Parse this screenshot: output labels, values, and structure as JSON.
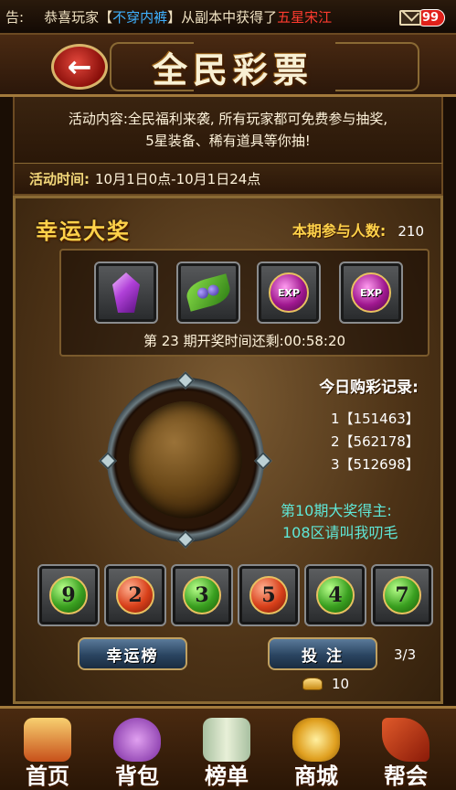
{
  "notice": {
    "label": "告:",
    "prefix": "恭喜玩家",
    "bracket_open": "【",
    "player": "不穿内裤",
    "bracket_close": "】",
    "middle": "从副本中获得了",
    "item": "五星宋江",
    "mail_count": "99"
  },
  "header": {
    "back_icon": "←",
    "title": "全民彩票"
  },
  "description": {
    "line1": "活动内容:全民福利来袭, 所有玩家都可免费参与抽奖,",
    "line2": "5星装备、稀有道具等你抽!"
  },
  "activity_time": {
    "label": "活动时间:",
    "value": "10月1日0点-10月1日24点"
  },
  "lucky": {
    "title": "幸运大奖",
    "participants_label": "本期参与人数:",
    "participants": "210",
    "prizes": [
      {
        "icon": "purple-crystal-icon"
      },
      {
        "icon": "herb-leaf-icon"
      },
      {
        "icon": "exp-orb-icon",
        "text": "EXP"
      },
      {
        "icon": "exp-orb-icon",
        "text": "EXP"
      }
    ],
    "countdown_prefix": "第",
    "round": "23",
    "countdown_mid": "期开奖时间还剩:",
    "countdown": "00:58:20"
  },
  "records": {
    "title": "今日购彩记录:",
    "items": [
      "1【151463】",
      "2【562178】",
      "3【512698】"
    ]
  },
  "winner": {
    "label": "第10期大奖得主:",
    "name": "108区请叫我叨毛"
  },
  "balls": [
    {
      "number": "9",
      "color": "green"
    },
    {
      "number": "2",
      "color": "red"
    },
    {
      "number": "3",
      "color": "green"
    },
    {
      "number": "5",
      "color": "red"
    },
    {
      "number": "4",
      "color": "green"
    },
    {
      "number": "7",
      "color": "green"
    }
  ],
  "actions": {
    "ranking_label": "幸运榜",
    "bet_label": "投 注",
    "bet_count": "3/3",
    "gold": "10"
  },
  "nav": [
    {
      "label": "首页",
      "icon": "palace-icon"
    },
    {
      "label": "背包",
      "icon": "bag-icon"
    },
    {
      "label": "榜单",
      "icon": "scroll-icon"
    },
    {
      "label": "商城",
      "icon": "gold-ingot-icon"
    },
    {
      "label": "帮会",
      "icon": "guild-banner-icon"
    }
  ],
  "colors": {
    "accent_gold": "#ffd24a",
    "winner_cyan": "#5fe8d8",
    "player_blue": "#3fb1ff",
    "item_red": "#ff3b2f"
  }
}
